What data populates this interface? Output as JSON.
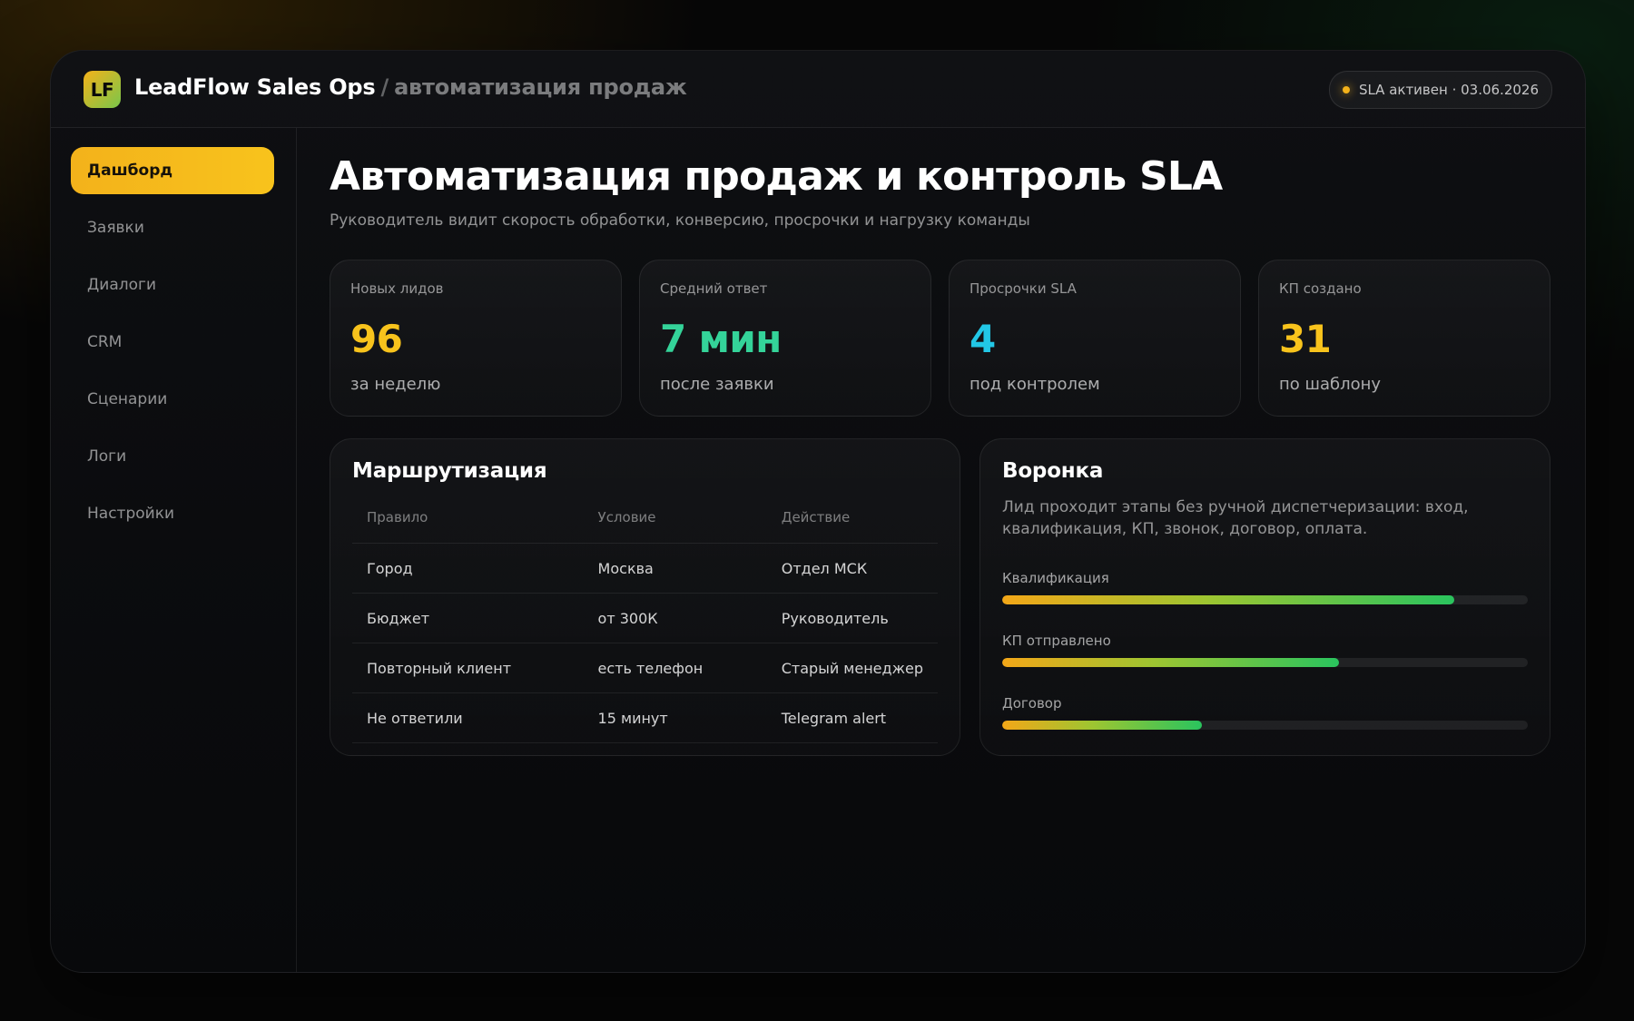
{
  "app": {
    "logo_text": "LF",
    "brand_name": "LeadFlow Sales Ops",
    "brand_sep": "/",
    "brand_sub": "автоматизация продаж",
    "status": "SLA активен · 03.06.2026"
  },
  "sidebar": {
    "items": [
      {
        "label": "Дашборд",
        "active": true
      },
      {
        "label": "Заявки"
      },
      {
        "label": "Диалоги"
      },
      {
        "label": "CRM"
      },
      {
        "label": "Сценарии"
      },
      {
        "label": "Логи"
      },
      {
        "label": "Настройки"
      }
    ]
  },
  "main": {
    "title": "Автоматизация продаж и контроль SLA",
    "subtitle": "Руководитель видит скорость обработки, конверсию, просрочки и нагрузку команды"
  },
  "kpis": [
    {
      "label": "Новых лидов",
      "value": "96",
      "hint": "за неделю",
      "color": "#f8c31c"
    },
    {
      "label": "Средний ответ",
      "value": "7 мин",
      "hint": "после заявки",
      "color": "#34d399"
    },
    {
      "label": "Просрочки SLA",
      "value": "4",
      "hint": "под контролем",
      "color": "#22c7e6"
    },
    {
      "label": "КП создано",
      "value": "31",
      "hint": "по шаблону",
      "color": "#f8c31c"
    }
  ],
  "routing": {
    "title": "Маршрутизация",
    "headers": [
      "Правило",
      "Условие",
      "Действие"
    ],
    "rows": [
      [
        "Город",
        "Москва",
        "Отдел МСК"
      ],
      [
        "Бюджет",
        "от 300К",
        "Руководитель"
      ],
      [
        "Повторный клиент",
        "есть телефон",
        "Старый менеджер"
      ],
      [
        "Не ответили",
        "15 минут",
        "Telegram alert"
      ]
    ]
  },
  "funnel": {
    "title": "Воронка",
    "description": "Лид проходит этапы без ручной диспетчеризации: вход, квалификация, КП, звонок, договор, оплата.",
    "stages": [
      {
        "label": "Квалификация",
        "percent": 86
      },
      {
        "label": "КП отправлено",
        "percent": 64
      },
      {
        "label": "Договор",
        "percent": 38
      }
    ]
  },
  "colors": {
    "accent": "#f8c31c",
    "green": "#2ac45e",
    "background": "#070707"
  }
}
